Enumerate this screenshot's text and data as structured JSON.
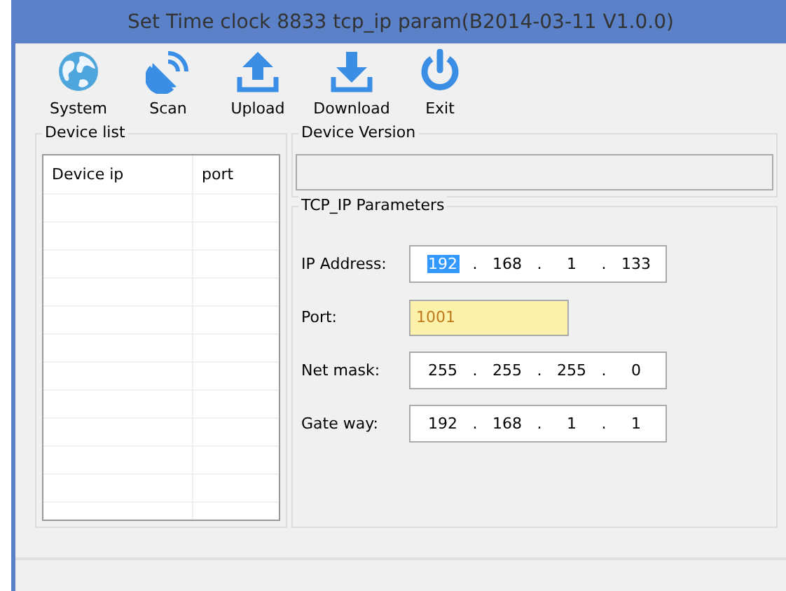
{
  "window": {
    "title": "Set Time clock 8833 tcp_ip param(B2014-03-11 V1.0.0)"
  },
  "toolbar": [
    {
      "kind": "globe",
      "label": "System"
    },
    {
      "kind": "satellite",
      "label": "Scan"
    },
    {
      "kind": "upload",
      "label": "Upload"
    },
    {
      "kind": "download",
      "label": "Download"
    },
    {
      "kind": "power",
      "label": "Exit"
    }
  ],
  "device_list": {
    "title": "Device list",
    "columns": [
      "Device ip",
      "port"
    ]
  },
  "device_version": {
    "title": "Device Version"
  },
  "tcp_ip": {
    "title": "TCP_IP Parameters",
    "fields": [
      {
        "label": "IP Address:",
        "kind": "ip",
        "separator": ".",
        "octets": [
          {
            "text": "192",
            "selected": true
          },
          {
            "text": "168",
            "selected": false
          },
          {
            "text": "1",
            "selected": false
          },
          {
            "text": "133",
            "selected": false
          }
        ]
      },
      {
        "label": "Port:",
        "kind": "text",
        "value": "1001",
        "highlighted": true
      },
      {
        "label": "Net mask:",
        "kind": "ip",
        "separator": ".",
        "octets": [
          {
            "text": "255",
            "selected": false
          },
          {
            "text": "255",
            "selected": false
          },
          {
            "text": "255",
            "selected": false
          },
          {
            "text": "0",
            "selected": false
          }
        ]
      },
      {
        "label": "Gate way:",
        "kind": "ip",
        "separator": ".",
        "octets": [
          {
            "text": "192",
            "selected": false
          },
          {
            "text": "168",
            "selected": false
          },
          {
            "text": "1",
            "selected": false
          },
          {
            "text": "1",
            "selected": false
          }
        ]
      }
    ]
  }
}
